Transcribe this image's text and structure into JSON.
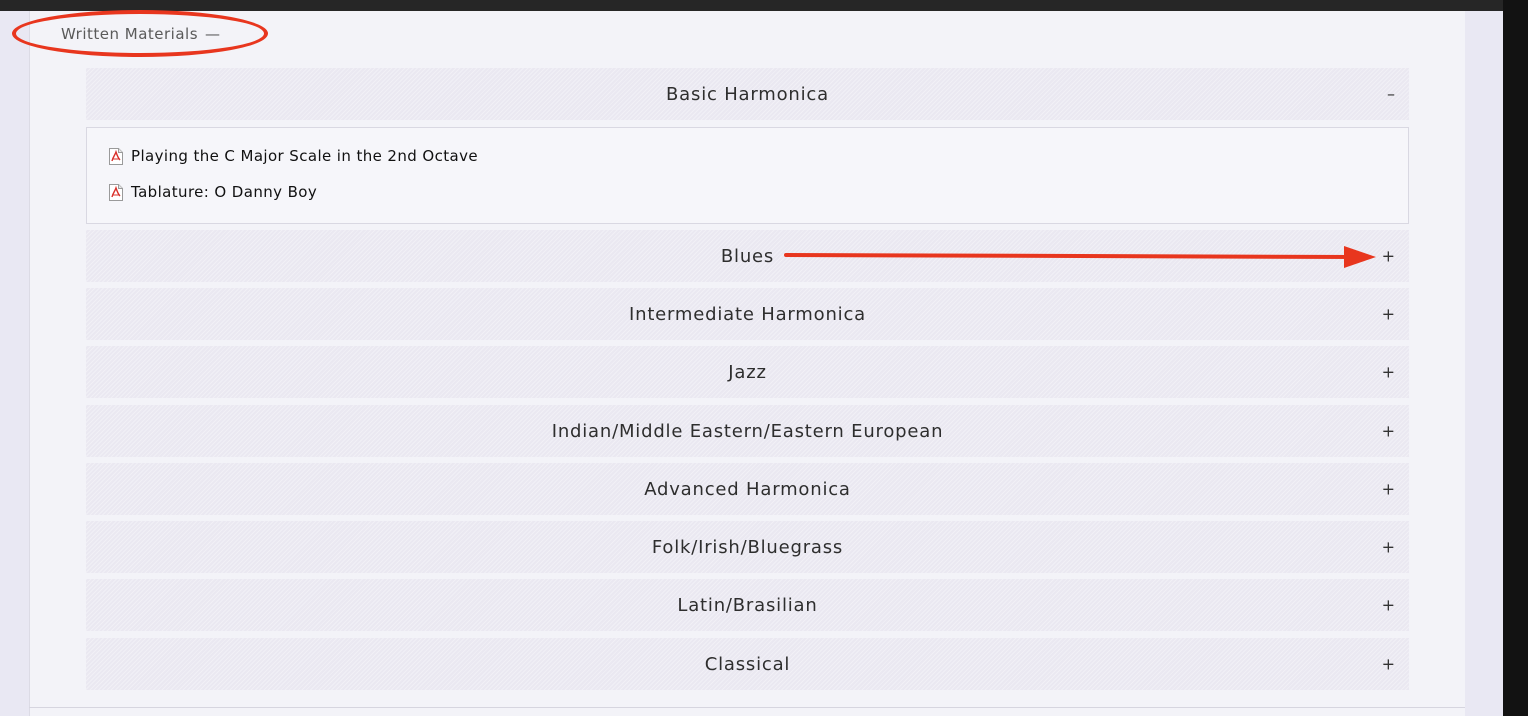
{
  "section": {
    "title": "Written Materials",
    "toggle_symbol": "—"
  },
  "accordion": {
    "items": [
      {
        "title": "Basic Harmonica",
        "toggle": "–",
        "expanded": true,
        "files": [
          {
            "label": "Playing the C Major Scale in the 2nd Octave",
            "icon": "pdf-icon"
          },
          {
            "label": "Tablature: O Danny Boy",
            "icon": "pdf-icon"
          }
        ]
      },
      {
        "title": "Blues",
        "toggle": "+",
        "expanded": false
      },
      {
        "title": "Intermediate Harmonica",
        "toggle": "+",
        "expanded": false
      },
      {
        "title": "Jazz",
        "toggle": "+",
        "expanded": false
      },
      {
        "title": "Indian/Middle Eastern/Eastern European",
        "toggle": "+",
        "expanded": false
      },
      {
        "title": "Advanced Harmonica",
        "toggle": "+",
        "expanded": false
      },
      {
        "title": "Folk/Irish/Bluegrass",
        "toggle": "+",
        "expanded": false
      },
      {
        "title": "Latin/Brasilian",
        "toggle": "+",
        "expanded": false
      },
      {
        "title": "Classical",
        "toggle": "+",
        "expanded": false
      }
    ]
  },
  "annotations": {
    "color": "#e8361e"
  },
  "colors": {
    "accordion_header_bg": "#eae8f1",
    "panel_bg": "#f3f3f8",
    "page_bg": "#e9e8f3",
    "top_bar": "#262626"
  }
}
